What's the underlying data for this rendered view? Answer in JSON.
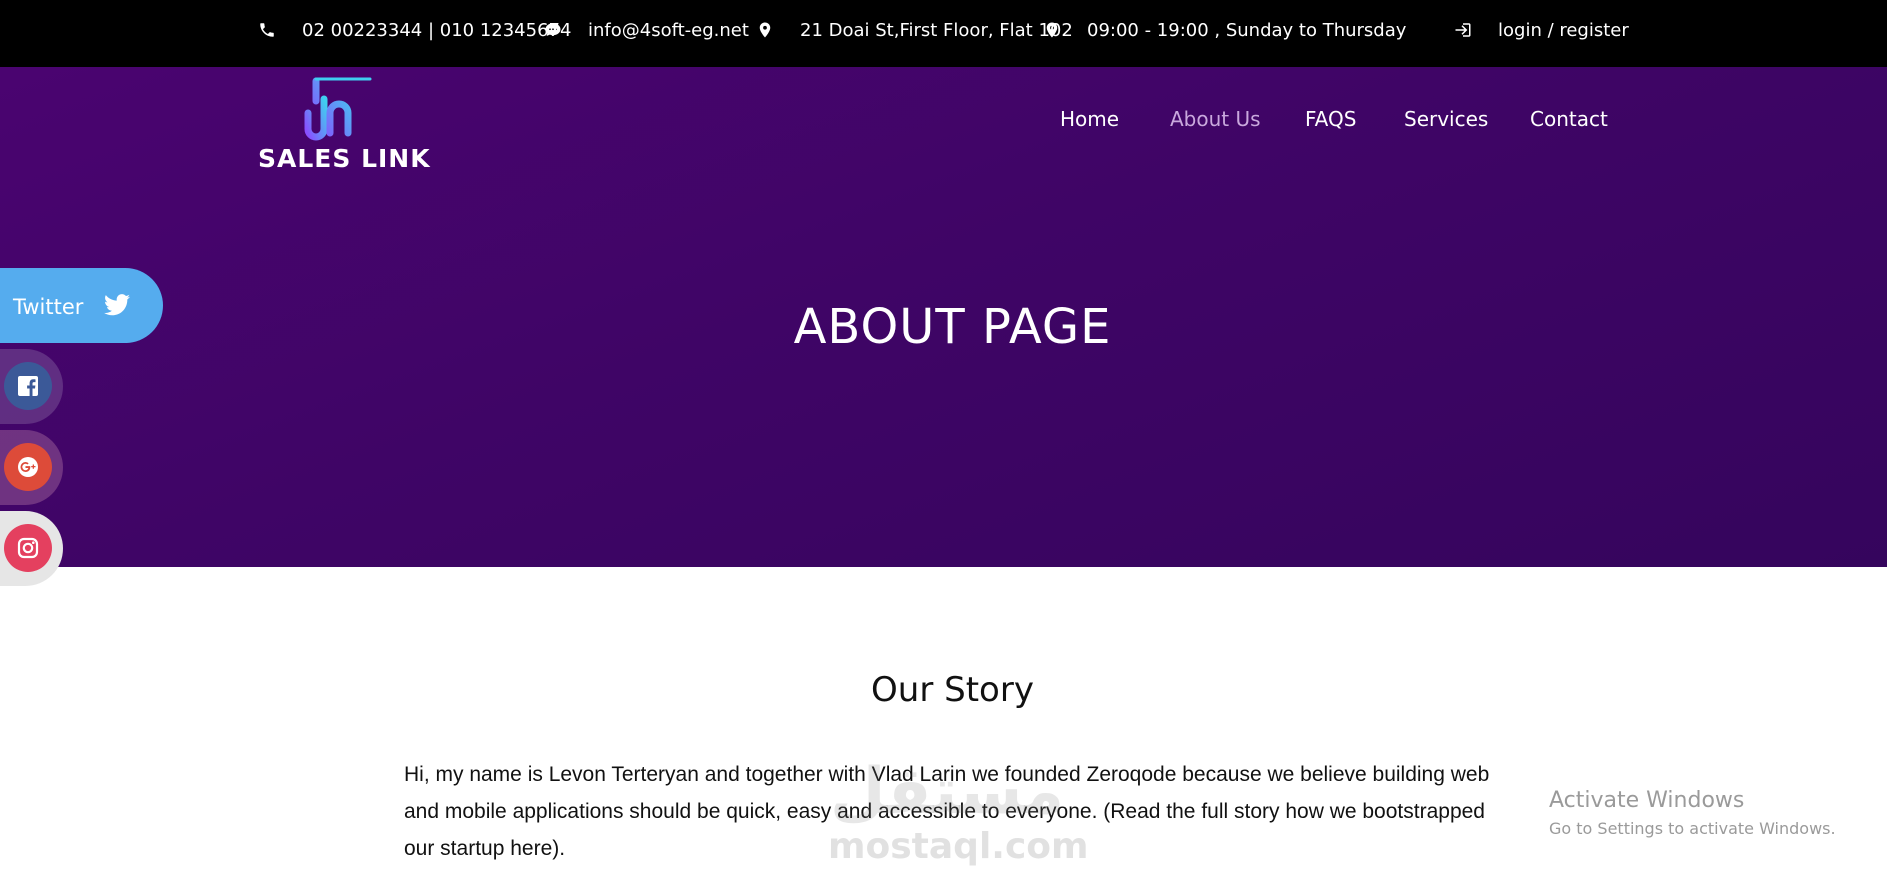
{
  "topbar": {
    "phone": "02 00223344 | 010 12345674",
    "email": "info@4soft-eg.net",
    "address": "21 Doai St,First Floor, Flat 102",
    "hours": "09:00 - 19:00 , Sunday to Thursday",
    "login": "login / register"
  },
  "logo": {
    "text": "SALES LINK",
    "colors": [
      "#8a4dff",
      "#3fd0f0"
    ]
  },
  "nav": {
    "items": [
      {
        "label": "Home"
      },
      {
        "label": "About Us",
        "active": true
      },
      {
        "label": "FAQS"
      },
      {
        "label": "Services"
      },
      {
        "label": "Contact"
      }
    ]
  },
  "hero": {
    "title": "ABOUT PAGE",
    "background": "#420567"
  },
  "social": {
    "twitter_label": "Twitter",
    "items": [
      {
        "name": "twitter",
        "icon": "twitter-icon",
        "color": "#55acee"
      },
      {
        "name": "facebook",
        "icon": "facebook-icon",
        "color": "#3b5998"
      },
      {
        "name": "google-plus",
        "icon": "google-plus-icon",
        "color": "#dd4b39"
      },
      {
        "name": "instagram",
        "icon": "instagram-icon",
        "color": "#e4405f"
      }
    ]
  },
  "story": {
    "title": "Our Story",
    "text": "Hi, my name is Levon Terteryan and together with Vlad Larin we founded Zeroqode because we believe building web and mobile applications should be quick, easy and accessible to everyone. (Read the full story how we bootstrapped our startup here)."
  },
  "watermark": {
    "site": "mostaql.com"
  },
  "windows_notice": {
    "title": "Activate Windows",
    "subtitle": "Go to Settings to activate Windows."
  }
}
